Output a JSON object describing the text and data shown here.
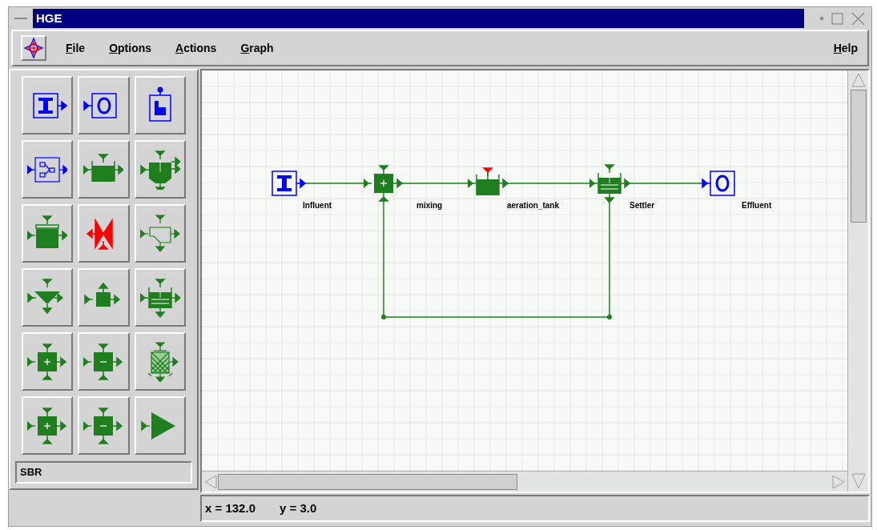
{
  "window": {
    "title": "HGE"
  },
  "menu": [
    {
      "label": "File"
    },
    {
      "label": "Options"
    },
    {
      "label": "Actions"
    },
    {
      "label": "Graph"
    }
  ],
  "help_menu": {
    "label": "Help"
  },
  "palette": {
    "tools": [
      {
        "kind": "influent"
      },
      {
        "kind": "effluent"
      },
      {
        "kind": "bypass"
      },
      {
        "kind": "combiner"
      },
      {
        "kind": "tank"
      },
      {
        "kind": "stirred"
      },
      {
        "kind": "covered"
      },
      {
        "kind": "valve"
      },
      {
        "kind": "clarifier"
      },
      {
        "kind": "hopper"
      },
      {
        "kind": "junction"
      },
      {
        "kind": "settler"
      },
      {
        "kind": "adder"
      },
      {
        "kind": "subtractor"
      },
      {
        "kind": "filter"
      },
      {
        "kind": "adder"
      },
      {
        "kind": "subtractor"
      },
      {
        "kind": "pump"
      }
    ],
    "model": "SBR"
  },
  "graph": {
    "nodes": [
      {
        "kind": "influent",
        "label": "Influent"
      },
      {
        "kind": "adder",
        "label": "mixing"
      },
      {
        "kind": "aerated",
        "label": "aeration_tank"
      },
      {
        "kind": "settler",
        "label": "Settler"
      },
      {
        "kind": "effluent",
        "label": "Effluent"
      }
    ]
  },
  "status_bar": {
    "x": "x = 132.0",
    "y": "y = 3.0"
  }
}
